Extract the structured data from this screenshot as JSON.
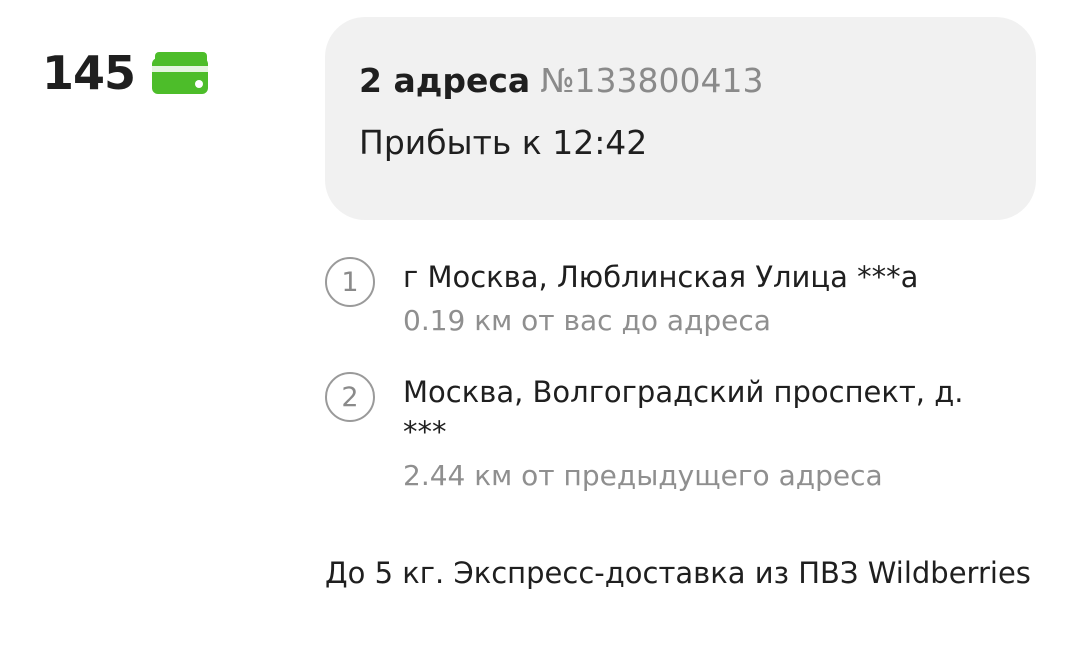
{
  "price": {
    "value": "145",
    "icon": "payment-card-icon",
    "icon_color": "#4dbd2a"
  },
  "order": {
    "count_label": "2 адреса",
    "number": "№133800413",
    "arrival": "Прибыть к 12:42"
  },
  "stops": [
    {
      "index": "1",
      "address": "г Москва, Люблинская Улица ***а",
      "distance": "0.19 км от вас до адреса"
    },
    {
      "index": "2",
      "address": "Москва, Волгоградский проспект, д. ***",
      "distance": "2.44 км от предыдущего адреса"
    }
  ],
  "footer": {
    "description": "До 5 кг. Экспресс-доставка из ПВЗ Wildberries"
  }
}
